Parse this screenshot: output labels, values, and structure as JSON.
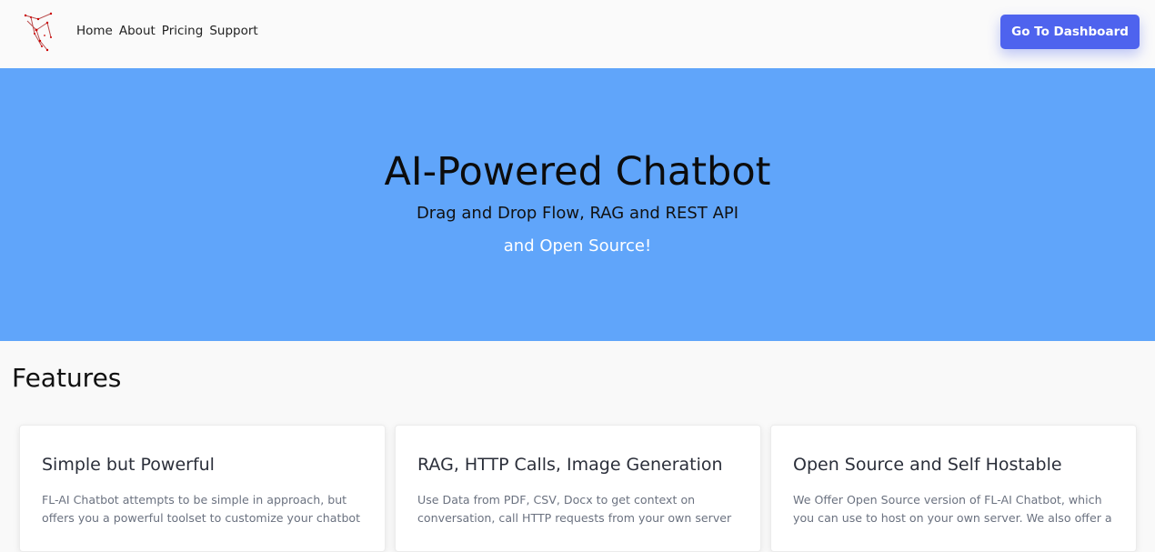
{
  "navbar": {
    "logo_name": "logo-icon",
    "links": [
      "Home",
      "About",
      "Pricing",
      "Support"
    ],
    "dashboard_button": "Go To Dashboard"
  },
  "hero": {
    "title": "AI-Powered Chatbot",
    "subtitle": "Drag and Drop Flow, RAG and REST API",
    "tagline": "and Open Source!"
  },
  "features": {
    "heading": "Features",
    "cards": [
      {
        "title": "Simple but Powerful",
        "text": "FL-AI Chatbot attempts to be simple in approach, but offers you a powerful toolset to customize your chatbot"
      },
      {
        "title": "RAG, HTTP Calls, Image Generation",
        "text": "Use Data from PDF, CSV, Docx to get context on conversation, call HTTP requests from your own server"
      },
      {
        "title": "Open Source and Self Hostable",
        "text": "We Offer Open Source version of FL-AI Chatbot, which you can use to host on your own server. We also offer a"
      }
    ]
  },
  "colors": {
    "hero_bg": "#60a5fa",
    "button_bg": "#4e63ee",
    "page_bg": "#f9f9f9"
  }
}
